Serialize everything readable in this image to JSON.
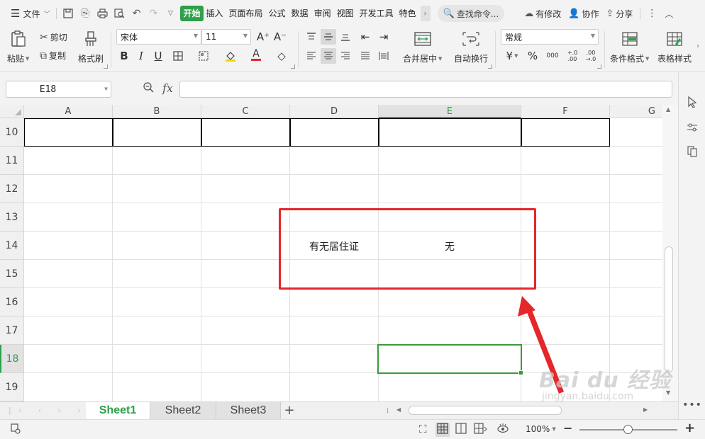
{
  "menubar": {
    "file_label": "文件",
    "tabs": [
      "开始",
      "插入",
      "页面布局",
      "公式",
      "数据",
      "审阅",
      "视图",
      "开发工具",
      "特色"
    ],
    "search_label": "查找命令...",
    "modified_label": "有修改",
    "collab_label": "协作",
    "share_label": "分享"
  },
  "ribbon": {
    "paste_label": "粘贴",
    "cut_label": "剪切",
    "copy_label": "复制",
    "format_painter_label": "格式刷",
    "font_name": "宋体",
    "font_size": "11",
    "merge_label": "合并居中",
    "wrap_label": "自动换行",
    "number_format": "常规",
    "conditional_label": "条件格式",
    "table_style_label": "表格样式",
    "bold": "B",
    "italic": "I",
    "underline": "U",
    "font_color_letter": "A",
    "grow_font": "A⁺",
    "shrink_font": "A⁻",
    "currency": "¥",
    "percent": "%",
    "thousands": "000",
    "inc_decimal": "+.0 .00",
    "dec_decimal": ".00 →.0"
  },
  "formula_bar": {
    "name_box": "E18",
    "fx": "fx",
    "formula": ""
  },
  "grid": {
    "columns": [
      "A",
      "B",
      "C",
      "D",
      "E",
      "F",
      "G"
    ],
    "rows": [
      "10",
      "11",
      "12",
      "13",
      "14",
      "15",
      "16",
      "17",
      "18",
      "19"
    ],
    "selected_column": "E",
    "selected_row": "18",
    "cells": {
      "D14": "有无居住证",
      "E14": "无"
    }
  },
  "sheets": {
    "tabs": [
      "Sheet1",
      "Sheet2",
      "Sheet3"
    ],
    "active": "Sheet1",
    "add": "+"
  },
  "statusbar": {
    "zoom": "100%",
    "minus": "−",
    "plus": "+"
  },
  "watermark": {
    "main": "Bai du 经验",
    "sub": "jingyan.baidu.com"
  },
  "colors": {
    "accent": "#2ea04a",
    "annotation": "#e5262a",
    "selection": "#3a9b3a"
  }
}
